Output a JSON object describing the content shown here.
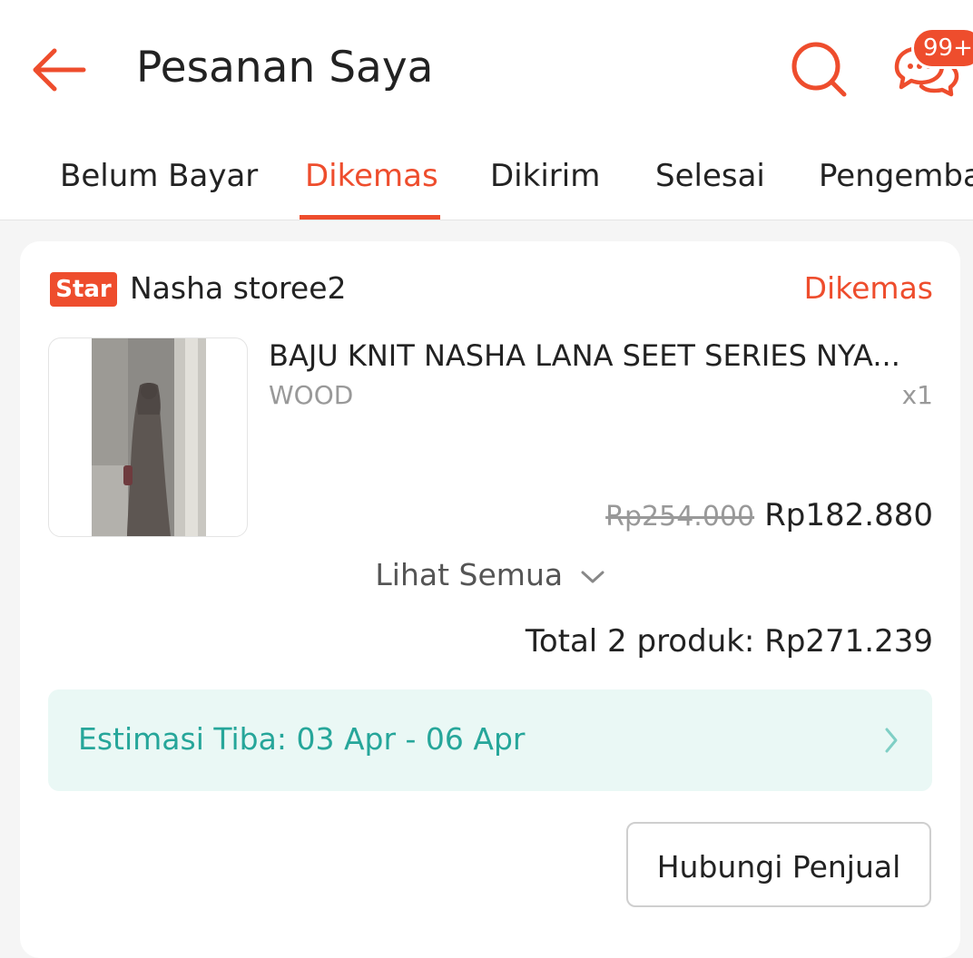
{
  "header": {
    "title": "Pesanan Saya",
    "chat_badge": "99+",
    "accent_color": "#ee4d2d"
  },
  "icons": {
    "back": "arrow-left-icon",
    "search": "search-icon",
    "chat": "chat-icon",
    "chevron_down": "chevron-down-icon",
    "chevron_right": "chevron-right-icon"
  },
  "tabs": [
    {
      "label": "Belum Bayar",
      "active": false
    },
    {
      "label": "Dikemas",
      "active": true
    },
    {
      "label": "Dikirim",
      "active": false
    },
    {
      "label": "Selesai",
      "active": false
    },
    {
      "label": "Pengemba",
      "active": false
    }
  ],
  "order": {
    "shop_badge": "Star",
    "shop_name": "Nasha storee2",
    "status": "Dikemas",
    "product": {
      "name": "BAJU KNIT NASHA LANA SEET SERIES NYA...",
      "variation": "WOOD",
      "quantity": "x1",
      "price_original": "Rp254.000",
      "price_final": "Rp182.880"
    },
    "view_all_label": "Lihat Semua",
    "total_label": "Total 2 produk: Rp271.239",
    "eta_label": "Estimasi Tiba: 03 Apr - 06 Apr",
    "eta_color": "#26a69a",
    "contact_button": "Hubungi Penjual"
  }
}
